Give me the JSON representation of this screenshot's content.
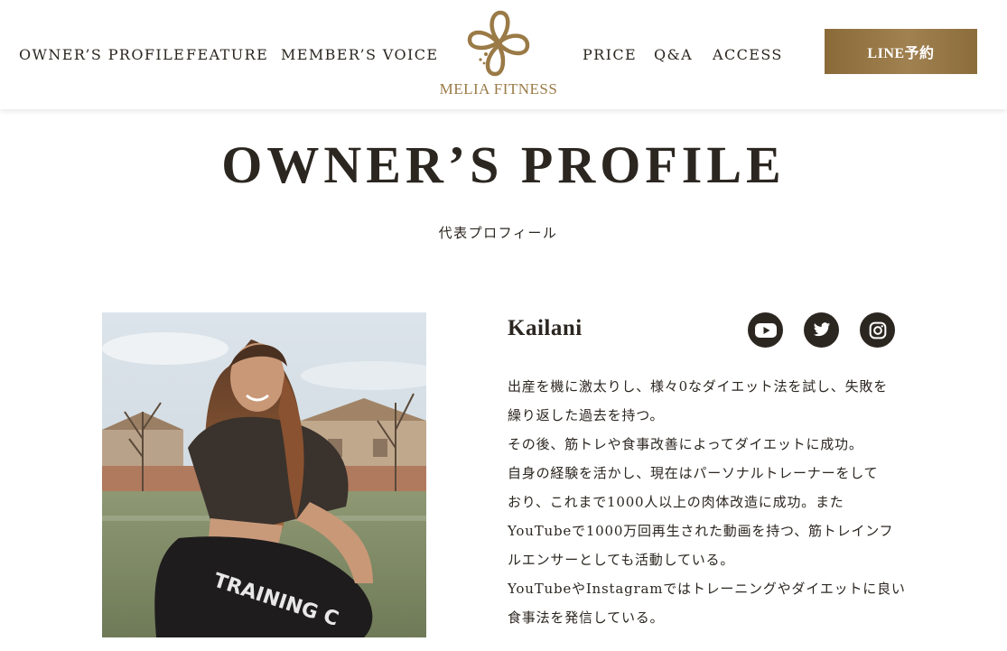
{
  "header": {
    "nav_left": [
      "OWNER’S PROFILE",
      "FEATURE",
      "MEMBER’S VOICE"
    ],
    "nav_right": [
      "PRICE",
      "Q&A",
      "ACCESS"
    ],
    "logo_text": "MELIA FITNESS",
    "line_button_label": "LINE予約"
  },
  "section": {
    "title": "OWNER’S PROFILE",
    "subtitle": "代表プロフィール"
  },
  "profile": {
    "name": "Kailani",
    "photo_shirt_text": "TRAINING C",
    "social_icons": [
      "youtube-icon",
      "twitter-icon",
      "instagram-icon"
    ],
    "bio_lines": [
      "出産を機に激太りし、様々0なダイエット法を試し、失敗を",
      "繰り返した過去を持つ。",
      "その後、筋トレや食事改善によってダイエットに成功。",
      "自身の経験を活かし、現在はパーソナルトレーナーをして",
      "おり、これまで1000人以上の肉体改造に成功。また",
      "YouTubeで1000万回再生された動画を持つ、筋トレインフ",
      "ルエンサーとしても活動している。",
      "YouTubeやInstagramではトレーニングやダイエットに良い",
      "食事法を発信している。"
    ]
  },
  "colors": {
    "accent_gold": "#9a7a46",
    "text_dark": "#2b2620",
    "button_gradient_start": "#8a6a38",
    "button_gradient_end": "#a08150"
  }
}
